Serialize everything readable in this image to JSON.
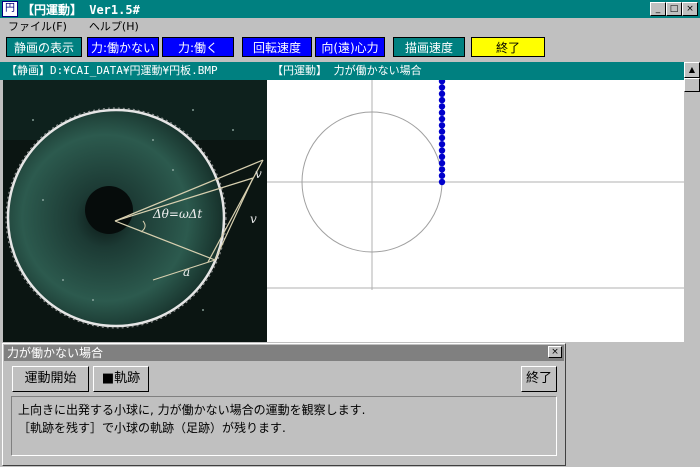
{
  "window": {
    "title": "【円運動】 Ver1.5#",
    "icon": "app-icon",
    "buttons": {
      "minimize": "_",
      "maximize": "□",
      "close": "×"
    }
  },
  "menu": {
    "items": [
      {
        "label": "ファイル(F)"
      },
      {
        "label": "ヘルプ(H)"
      }
    ]
  },
  "toolbar": {
    "buttons": [
      {
        "label": "静画の表示"
      },
      {
        "label": "力:働かない"
      },
      {
        "label": "力:働く"
      },
      {
        "label": "回転速度"
      },
      {
        "label": "向(遠)心力"
      },
      {
        "label": "描画速度"
      },
      {
        "label": "終了"
      }
    ]
  },
  "header": {
    "left": "【静画】D:¥CAI_DATA¥円運動¥円板.BMP",
    "right": "【円運動】 力が働かない場合"
  },
  "photo": {
    "formula": "Δθ=ωΔt",
    "label_v1": "v",
    "label_v2": "v",
    "label_a": "a"
  },
  "colors": {
    "teal": "#008080",
    "blue": "#0000ff",
    "yellow": "#ffff00",
    "dot": "#0000cc"
  },
  "dialog": {
    "title": "力が働かない場合",
    "start_button": "運動開始",
    "trace_button": "■軌跡",
    "end_button": "終了",
    "message_line1": "上向きに出発する小球に, 力が働かない場合の運動を観察します.",
    "message_line2": "［軌跡を残す］で小球の軌跡（足跡）が残ります."
  }
}
